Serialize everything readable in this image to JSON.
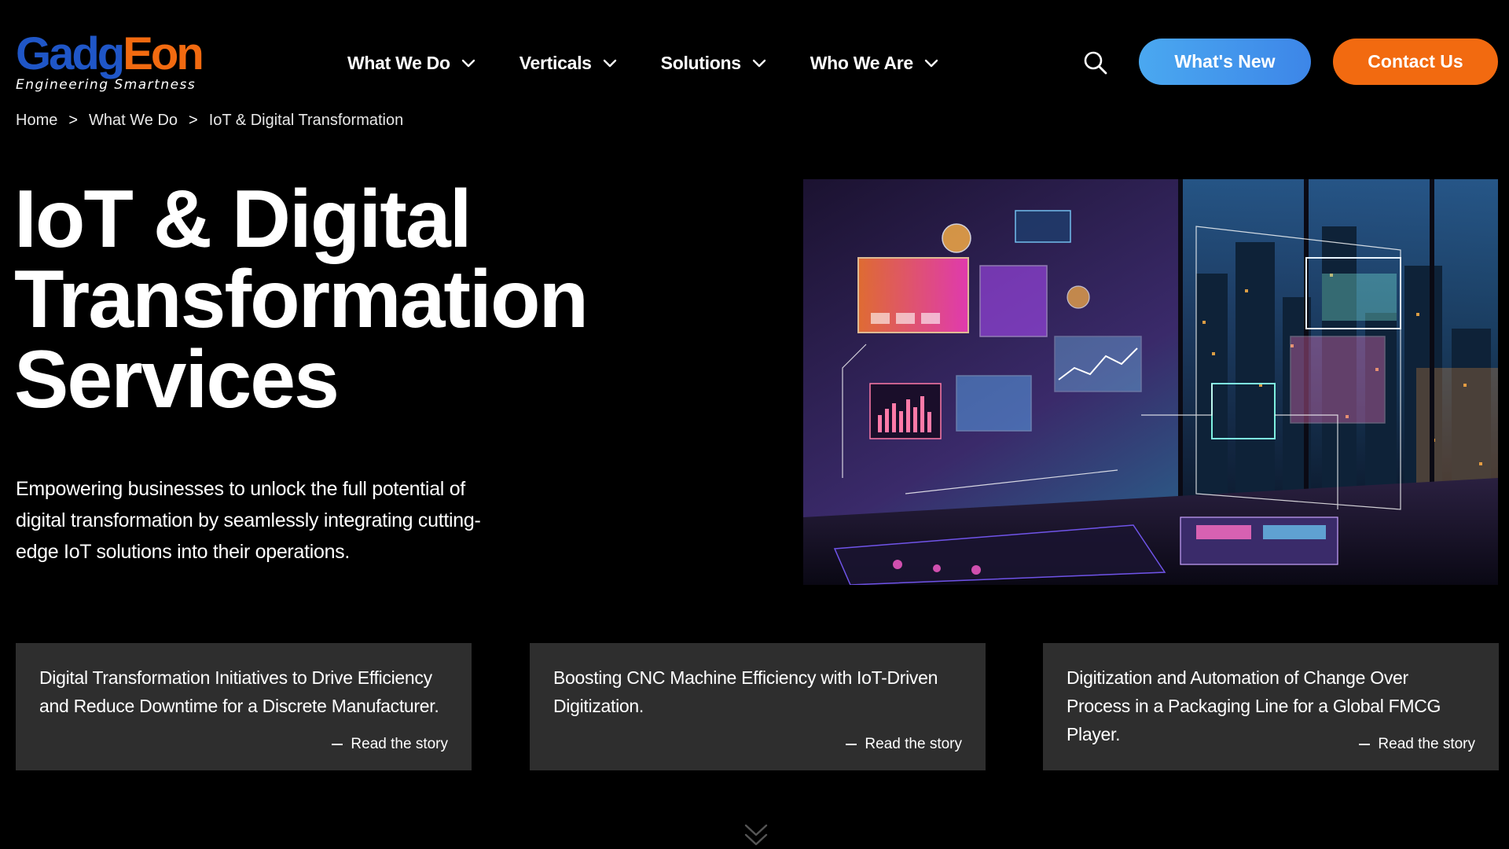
{
  "brand": {
    "name_part1": "Gadg",
    "name_part2": "Eon",
    "tagline": "Engineering Smartness",
    "colors": {
      "blue": "#1f56c7",
      "orange": "#f26a10"
    }
  },
  "nav": {
    "items": [
      {
        "label": "What We Do"
      },
      {
        "label": "Verticals"
      },
      {
        "label": "Solutions"
      },
      {
        "label": "Who We Are"
      }
    ],
    "search_icon": "search-icon",
    "whats_new_label": "What's New",
    "contact_label": "Contact Us"
  },
  "breadcrumb": {
    "items": [
      "Home",
      "What We Do",
      "IoT & Digital Transformation"
    ],
    "separator": ">"
  },
  "hero": {
    "title_lines": [
      "IoT & Digital",
      "Transformation",
      "Services"
    ],
    "description": "Empowering businesses to unlock the full potential of digital transformation by seamlessly integrating cutting-edge IoT solutions into their operations."
  },
  "cards": [
    {
      "text": "Digital Transformation Initiatives to Drive Efficiency and Reduce Downtime for a Discrete Manufacturer.",
      "link": "Read the story"
    },
    {
      "text": "Boosting CNC Machine Efficiency with IoT-Driven Digitization.",
      "link": "Read the story"
    },
    {
      "text": "Digitization and Automation of Change Over Process in a Packaging Line for a Global FMCG Player.",
      "link": "Read the story"
    }
  ],
  "colors": {
    "background": "#000000",
    "card_bg": "#2e2e2e",
    "accent_orange": "#f26a10",
    "accent_blue": "#3d86e8"
  }
}
